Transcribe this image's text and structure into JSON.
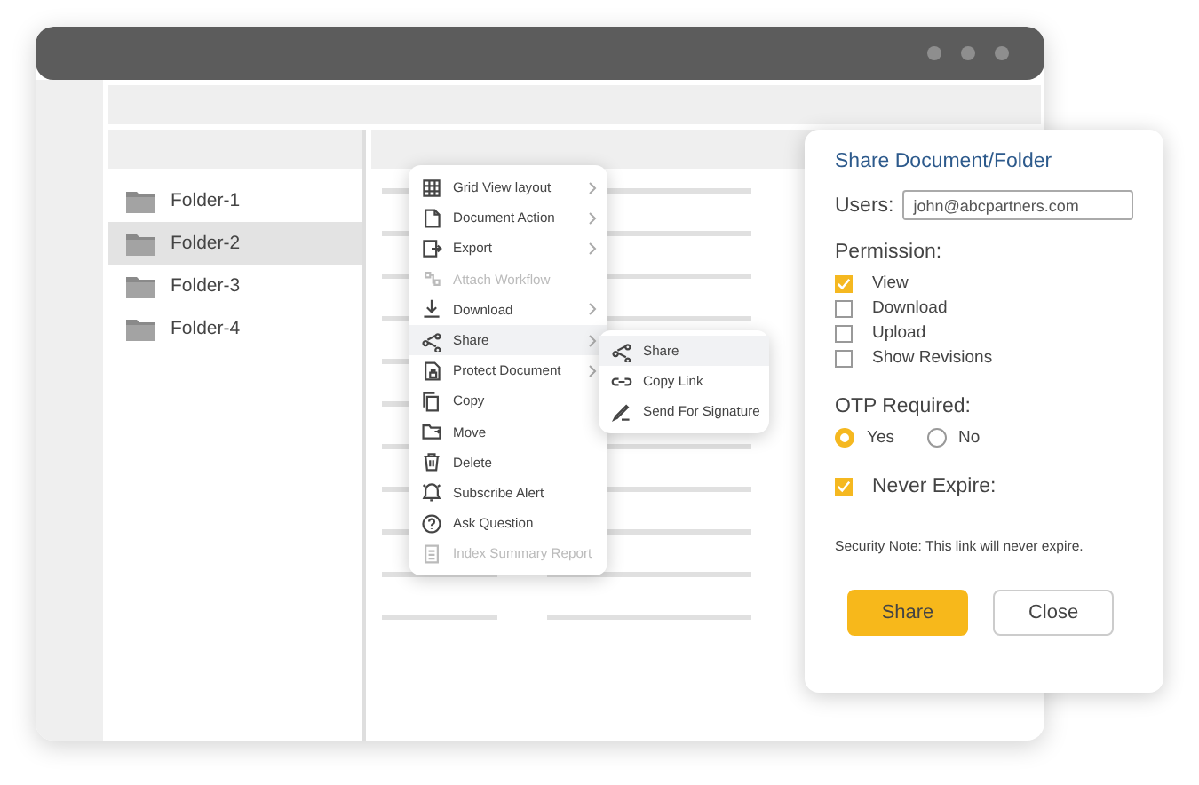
{
  "folders": [
    {
      "label": "Folder-1",
      "selected": false
    },
    {
      "label": "Folder-2",
      "selected": true
    },
    {
      "label": "Folder-3",
      "selected": false
    },
    {
      "label": "Folder-4",
      "selected": false
    }
  ],
  "context_menu": [
    {
      "label": "Grid View layout",
      "submenu": true,
      "disabled": false,
      "selected": false
    },
    {
      "label": "Document Action",
      "submenu": true,
      "disabled": false,
      "selected": false
    },
    {
      "label": "Export",
      "submenu": true,
      "disabled": false,
      "selected": false
    },
    {
      "label": "Attach Workflow",
      "submenu": false,
      "disabled": true,
      "selected": false
    },
    {
      "label": "Download",
      "submenu": true,
      "disabled": false,
      "selected": false
    },
    {
      "label": "Share",
      "submenu": true,
      "disabled": false,
      "selected": true
    },
    {
      "label": "Protect Document",
      "submenu": true,
      "disabled": false,
      "selected": false
    },
    {
      "label": "Copy",
      "submenu": false,
      "disabled": false,
      "selected": false
    },
    {
      "label": "Move",
      "submenu": false,
      "disabled": false,
      "selected": false
    },
    {
      "label": "Delete",
      "submenu": false,
      "disabled": false,
      "selected": false
    },
    {
      "label": "Subscribe Alert",
      "submenu": false,
      "disabled": false,
      "selected": false
    },
    {
      "label": "Ask Question",
      "submenu": false,
      "disabled": false,
      "selected": false
    },
    {
      "label": "Index Summary Report",
      "submenu": false,
      "disabled": true,
      "selected": false
    }
  ],
  "submenu": [
    {
      "label": "Share",
      "selected": true
    },
    {
      "label": "Copy Link",
      "selected": false
    },
    {
      "label": "Send For Signature",
      "selected": false
    }
  ],
  "dialog": {
    "title": "Share Document/Folder",
    "users_label": "Users:",
    "users_value": "john@abcpartners.com",
    "permission_label": "Permission:",
    "permissions": [
      {
        "label": "View",
        "checked": true
      },
      {
        "label": "Download",
        "checked": false
      },
      {
        "label": "Upload",
        "checked": false
      },
      {
        "label": "Show Revisions",
        "checked": false
      }
    ],
    "otp_label": "OTP Required:",
    "otp_options": [
      {
        "label": "Yes",
        "selected": true
      },
      {
        "label": "No",
        "selected": false
      }
    ],
    "never_expire": {
      "label": "Never Expire:",
      "checked": true
    },
    "note": "Security Note: This link will never expire.",
    "buttons": [
      {
        "label": "Share",
        "kind": "primary"
      },
      {
        "label": "Close",
        "kind": "secondary"
      }
    ]
  }
}
